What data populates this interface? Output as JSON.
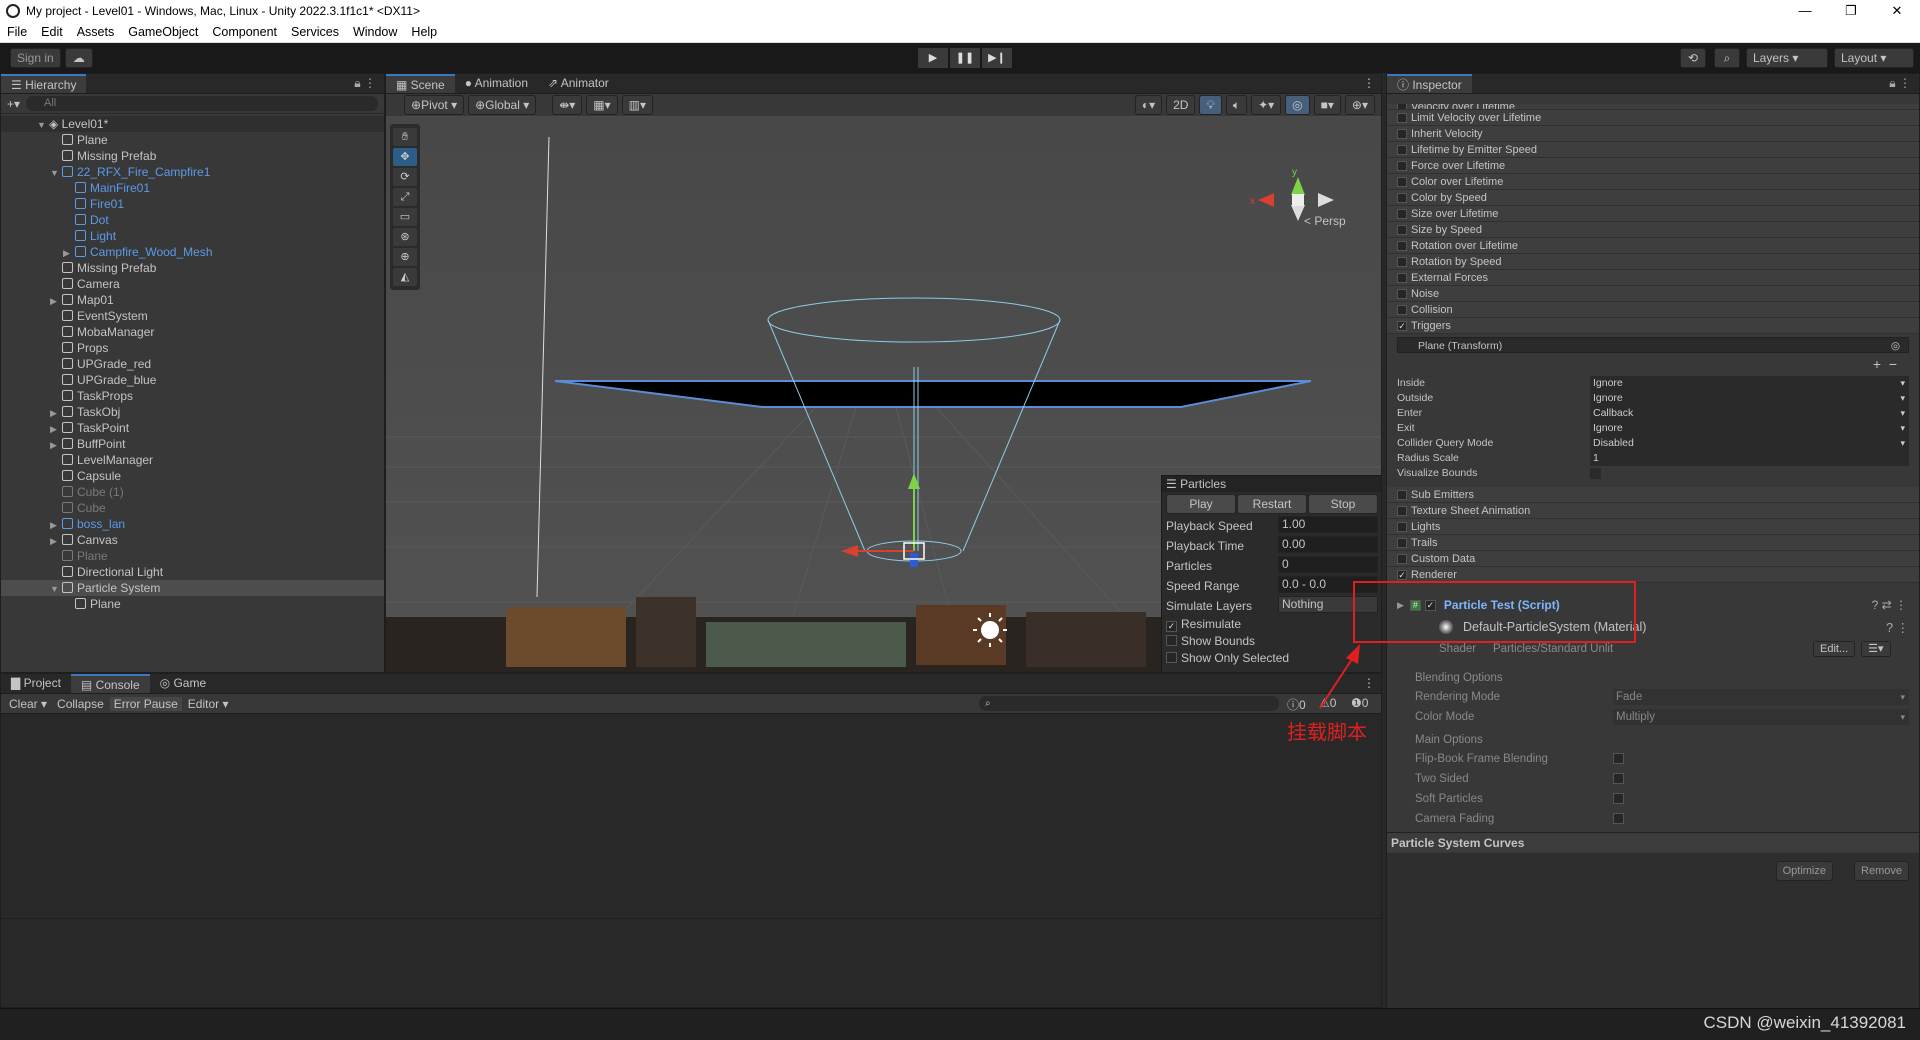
{
  "window": {
    "title": "My project - Level01 - Windows, Mac, Linux - Unity 2022.3.1f1c1* <DX11>",
    "min": "—",
    "max": "❐",
    "close": "✕"
  },
  "menu": [
    "File",
    "Edit",
    "Assets",
    "GameObject",
    "Component",
    "Services",
    "Window",
    "Help"
  ],
  "toolbar": {
    "signin": "Sign in",
    "layers": "Layers",
    "layout": "Layout"
  },
  "hierarchy": {
    "tab": "Hierarchy",
    "search_placeholder": "All",
    "root": "Level01*",
    "items": [
      {
        "label": "Plane",
        "depth": 1,
        "style": "normal",
        "arrow": ""
      },
      {
        "label": "Missing Prefab",
        "depth": 1,
        "style": "normal",
        "arrow": ""
      },
      {
        "label": "22_RFX_Fire_Campfire1",
        "depth": 1,
        "style": "blue",
        "arrow": "▼"
      },
      {
        "label": "MainFire01",
        "depth": 2,
        "style": "blue",
        "arrow": ""
      },
      {
        "label": "Fire01",
        "depth": 2,
        "style": "blue",
        "arrow": ""
      },
      {
        "label": "Dot",
        "depth": 2,
        "style": "blue",
        "arrow": ""
      },
      {
        "label": "Light",
        "depth": 2,
        "style": "blue",
        "arrow": ""
      },
      {
        "label": "Campfire_Wood_Mesh",
        "depth": 2,
        "style": "blue",
        "arrow": "▶"
      },
      {
        "label": "Missing Prefab",
        "depth": 1,
        "style": "normal",
        "arrow": ""
      },
      {
        "label": "Camera",
        "depth": 1,
        "style": "normal",
        "arrow": ""
      },
      {
        "label": "Map01",
        "depth": 1,
        "style": "normal",
        "arrow": "▶"
      },
      {
        "label": "EventSystem",
        "depth": 1,
        "style": "normal",
        "arrow": ""
      },
      {
        "label": "MobaManager",
        "depth": 1,
        "style": "normal",
        "arrow": ""
      },
      {
        "label": "Props",
        "depth": 1,
        "style": "normal",
        "arrow": ""
      },
      {
        "label": "UPGrade_red",
        "depth": 1,
        "style": "normal",
        "arrow": ""
      },
      {
        "label": "UPGrade_blue",
        "depth": 1,
        "style": "normal",
        "arrow": ""
      },
      {
        "label": "TaskProps",
        "depth": 1,
        "style": "normal",
        "arrow": ""
      },
      {
        "label": "TaskObj",
        "depth": 1,
        "style": "normal",
        "arrow": "▶"
      },
      {
        "label": "TaskPoint",
        "depth": 1,
        "style": "normal",
        "arrow": "▶"
      },
      {
        "label": "BuffPoint",
        "depth": 1,
        "style": "normal",
        "arrow": "▶"
      },
      {
        "label": "LevelManager",
        "depth": 1,
        "style": "normal",
        "arrow": ""
      },
      {
        "label": "Capsule",
        "depth": 1,
        "style": "normal",
        "arrow": ""
      },
      {
        "label": "Cube (1)",
        "depth": 1,
        "style": "dim",
        "arrow": ""
      },
      {
        "label": "Cube",
        "depth": 1,
        "style": "dim",
        "arrow": ""
      },
      {
        "label": "boss_lan",
        "depth": 1,
        "style": "blue",
        "arrow": "▶"
      },
      {
        "label": "Canvas",
        "depth": 1,
        "style": "normal",
        "arrow": "▶"
      },
      {
        "label": "Plane",
        "depth": 1,
        "style": "dim",
        "arrow": ""
      },
      {
        "label": "Directional Light",
        "depth": 1,
        "style": "normal",
        "arrow": ""
      },
      {
        "label": "Particle System",
        "depth": 1,
        "style": "selected",
        "arrow": "▼"
      },
      {
        "label": "Plane",
        "depth": 2,
        "style": "normal",
        "arrow": ""
      }
    ]
  },
  "scene": {
    "tabs": [
      "Scene",
      "Animation",
      "Animator"
    ],
    "pivot": "Pivot",
    "global": "Global",
    "mode2d": "2D",
    "persp": "< Persp",
    "particles": {
      "title": "Particles",
      "play": "Play",
      "restart": "Restart",
      "stop": "Stop",
      "rows": [
        {
          "label": "Playback Speed",
          "value": "1.00"
        },
        {
          "label": "Playback Time",
          "value": "0.00"
        },
        {
          "label": "Particles",
          "value": "0"
        },
        {
          "label": "Speed Range",
          "value": "0.0 - 0.0"
        },
        {
          "label": "Simulate Layers",
          "value": "Nothing"
        }
      ],
      "checks": [
        {
          "label": "Resimulate",
          "checked": "✓"
        },
        {
          "label": "Show Bounds",
          "checked": ""
        },
        {
          "label": "Show Only Selected",
          "checked": ""
        }
      ]
    }
  },
  "inspector": {
    "tab": "Inspector",
    "modules": [
      {
        "label": "Velocity over Lifetime",
        "checked": ""
      },
      {
        "label": "Limit Velocity over Lifetime",
        "checked": ""
      },
      {
        "label": "Inherit Velocity",
        "checked": ""
      },
      {
        "label": "Lifetime by Emitter Speed",
        "checked": ""
      },
      {
        "label": "Force over Lifetime",
        "checked": ""
      },
      {
        "label": "Color over Lifetime",
        "checked": ""
      },
      {
        "label": "Color by Speed",
        "checked": ""
      },
      {
        "label": "Size over Lifetime",
        "checked": ""
      },
      {
        "label": "Size by Speed",
        "checked": ""
      },
      {
        "label": "Rotation over Lifetime",
        "checked": ""
      },
      {
        "label": "Rotation by Speed",
        "checked": ""
      },
      {
        "label": "External Forces",
        "checked": ""
      },
      {
        "label": "Noise",
        "checked": ""
      },
      {
        "label": "Collision",
        "checked": ""
      },
      {
        "label": "Triggers",
        "checked": "✓"
      }
    ],
    "trigger_object": "Plane (Transform)",
    "trigger_props": [
      {
        "label": "Inside",
        "value": "Ignore"
      },
      {
        "label": "Outside",
        "value": "Ignore"
      },
      {
        "label": "Enter",
        "value": "Callback"
      },
      {
        "label": "Exit",
        "value": "Ignore"
      },
      {
        "label": "Collider Query Mode",
        "value": "Disabled"
      },
      {
        "label": "Radius Scale",
        "value": "1"
      },
      {
        "label": "Visualize Bounds",
        "value": ""
      }
    ],
    "modules2": [
      {
        "label": "Sub Emitters",
        "checked": ""
      },
      {
        "label": "Texture Sheet Animation",
        "checked": ""
      },
      {
        "label": "Lights",
        "checked": ""
      },
      {
        "label": "Trails",
        "checked": ""
      },
      {
        "label": "Custom Data",
        "checked": ""
      },
      {
        "label": "Renderer",
        "checked": "✓"
      }
    ],
    "script_component": "Particle Test (Script)",
    "material": "Default-ParticleSystem (Material)",
    "shader_label": "Shader",
    "shader_value": "Particles/Standard Unlit",
    "edit": "Edit...",
    "blending_header": "Blending Options",
    "blending": [
      {
        "label": "Rendering Mode",
        "value": "Fade"
      },
      {
        "label": "Color Mode",
        "value": "Multiply"
      }
    ],
    "main_header": "Main Options",
    "main_opts": [
      "Flip-Book Frame Blending",
      "Two Sided",
      "Soft Particles",
      "Camera Fading"
    ],
    "curves": "Particle System Curves",
    "optimize": "Optimize",
    "remove": "Remove"
  },
  "bottom": {
    "tabs": [
      "Project",
      "Console",
      "Game"
    ],
    "clear": "Clear",
    "collapse": "Collapse",
    "error_pause": "Error Pause",
    "editor": "Editor",
    "counts": [
      "0",
      "0",
      "0"
    ]
  },
  "annotation": {
    "text": "挂载脚本",
    "color": "#e02020"
  },
  "watermark": "CSDN @weixin_41392081"
}
